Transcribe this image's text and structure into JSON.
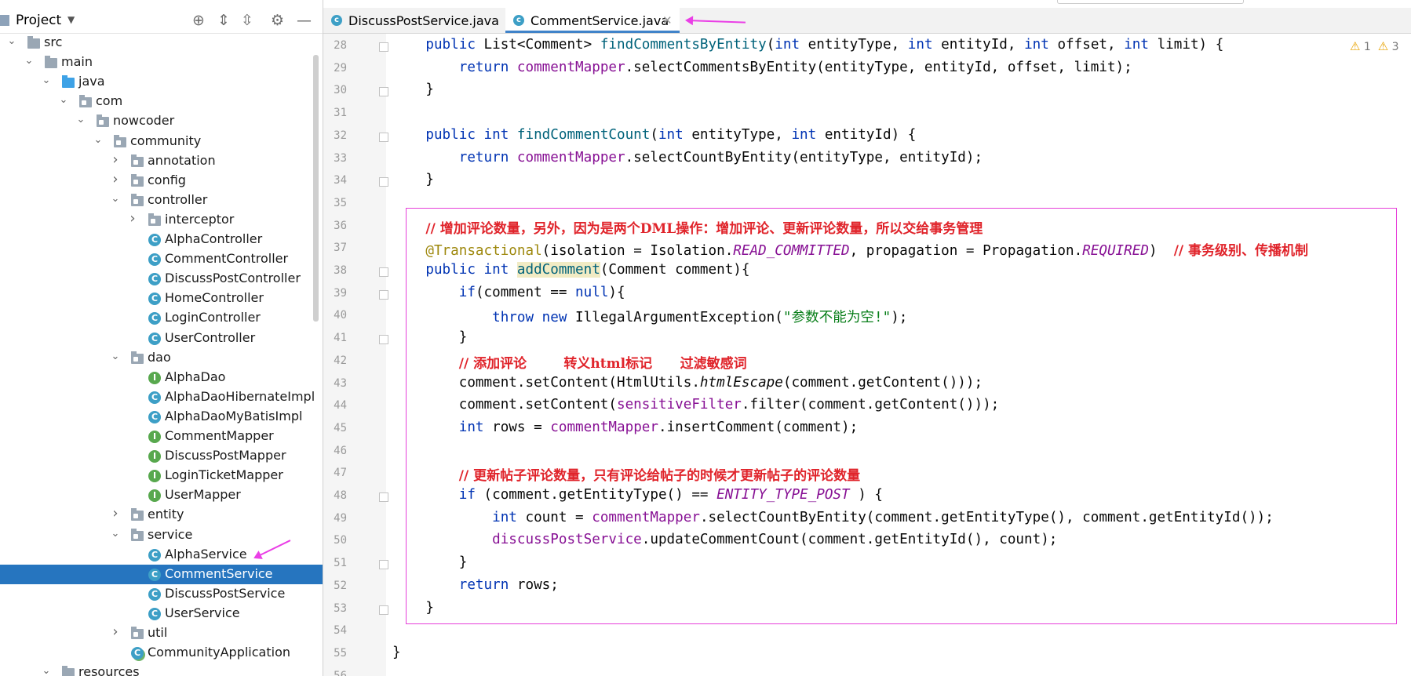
{
  "project_panel": {
    "title": "Project",
    "tree": [
      {
        "label": "src",
        "depth": 0,
        "expanded": true,
        "icon": "folder-icon"
      },
      {
        "label": "main",
        "depth": 1,
        "expanded": true,
        "icon": "folder-icon"
      },
      {
        "label": "java",
        "depth": 2,
        "expanded": true,
        "icon": "source-folder-icon"
      },
      {
        "label": "com",
        "depth": 3,
        "expanded": true,
        "icon": "package-icon"
      },
      {
        "label": "nowcoder",
        "depth": 4,
        "expanded": true,
        "icon": "package-icon"
      },
      {
        "label": "community",
        "depth": 5,
        "expanded": true,
        "icon": "package-icon"
      },
      {
        "label": "annotation",
        "depth": 6,
        "expanded": false,
        "icon": "package-icon"
      },
      {
        "label": "config",
        "depth": 6,
        "expanded": false,
        "icon": "package-icon"
      },
      {
        "label": "controller",
        "depth": 6,
        "expanded": true,
        "icon": "package-icon"
      },
      {
        "label": "interceptor",
        "depth": 7,
        "expanded": false,
        "icon": "package-icon"
      },
      {
        "label": "AlphaController",
        "depth": 7,
        "icon": "class-icon"
      },
      {
        "label": "CommentController",
        "depth": 7,
        "icon": "class-icon"
      },
      {
        "label": "DiscussPostController",
        "depth": 7,
        "icon": "class-icon"
      },
      {
        "label": "HomeController",
        "depth": 7,
        "icon": "class-icon"
      },
      {
        "label": "LoginController",
        "depth": 7,
        "icon": "class-icon"
      },
      {
        "label": "UserController",
        "depth": 7,
        "icon": "class-icon"
      },
      {
        "label": "dao",
        "depth": 6,
        "expanded": true,
        "icon": "package-icon"
      },
      {
        "label": "AlphaDao",
        "depth": 7,
        "icon": "interface-icon"
      },
      {
        "label": "AlphaDaoHibernateImpl",
        "depth": 7,
        "icon": "class-icon"
      },
      {
        "label": "AlphaDaoMyBatisImpl",
        "depth": 7,
        "icon": "class-icon"
      },
      {
        "label": "CommentMapper",
        "depth": 7,
        "icon": "interface-icon"
      },
      {
        "label": "DiscussPostMapper",
        "depth": 7,
        "icon": "interface-icon"
      },
      {
        "label": "LoginTicketMapper",
        "depth": 7,
        "icon": "interface-icon"
      },
      {
        "label": "UserMapper",
        "depth": 7,
        "icon": "interface-icon"
      },
      {
        "label": "entity",
        "depth": 6,
        "expanded": false,
        "icon": "package-icon"
      },
      {
        "label": "service",
        "depth": 6,
        "expanded": true,
        "icon": "package-icon"
      },
      {
        "label": "AlphaService",
        "depth": 7,
        "icon": "class-icon"
      },
      {
        "label": "CommentService",
        "depth": 7,
        "icon": "class-icon",
        "selected": true
      },
      {
        "label": "DiscussPostService",
        "depth": 7,
        "icon": "class-icon"
      },
      {
        "label": "UserService",
        "depth": 7,
        "icon": "class-icon"
      },
      {
        "label": "util",
        "depth": 6,
        "expanded": false,
        "icon": "package-icon"
      },
      {
        "label": "CommunityApplication",
        "depth": 6,
        "icon": "spring-app-icon"
      },
      {
        "label": "resources",
        "depth": 2,
        "expanded": true,
        "icon": "folder-icon"
      }
    ]
  },
  "tabs": [
    {
      "label": "DiscussPostService.java",
      "active": false
    },
    {
      "label": "CommentService.java",
      "active": true
    }
  ],
  "inspections": {
    "warnings": "1",
    "weak_warnings": "3"
  },
  "editor": {
    "lines": [
      {
        "n": "28",
        "tokens": [
          [
            "kw",
            "    public "
          ],
          [
            "",
            "List<Comment> "
          ],
          [
            "fn",
            "findCommentsByEntity"
          ],
          [
            "",
            "("
          ],
          [
            "kw",
            "int"
          ],
          [
            "",
            " entityType, "
          ],
          [
            "kw",
            "int"
          ],
          [
            "",
            " entityId, "
          ],
          [
            "kw",
            "int"
          ],
          [
            "",
            " offset, "
          ],
          [
            "kw",
            "int"
          ],
          [
            "",
            " limit) {"
          ]
        ]
      },
      {
        "n": "29",
        "tokens": [
          [
            "kw",
            "        return "
          ],
          [
            "fld",
            "commentMapper"
          ],
          [
            "",
            ".selectCommentsByEntity(entityType, entityId, offset, limit);"
          ]
        ]
      },
      {
        "n": "30",
        "tokens": [
          [
            "",
            "    }"
          ]
        ]
      },
      {
        "n": "31",
        "tokens": []
      },
      {
        "n": "32",
        "tokens": [
          [
            "kw",
            "    public int "
          ],
          [
            "fn",
            "findCommentCount"
          ],
          [
            "",
            "("
          ],
          [
            "kw",
            "int"
          ],
          [
            "",
            " entityType, "
          ],
          [
            "kw",
            "int"
          ],
          [
            "",
            " entityId) {"
          ]
        ]
      },
      {
        "n": "33",
        "tokens": [
          [
            "kw",
            "        return "
          ],
          [
            "fld",
            "commentMapper"
          ],
          [
            "",
            ".selectCountByEntity(entityType, entityId);"
          ]
        ]
      },
      {
        "n": "34",
        "tokens": [
          [
            "",
            "    }"
          ]
        ]
      },
      {
        "n": "35",
        "tokens": []
      },
      {
        "n": "36",
        "tokens": [
          [
            "",
            "    "
          ],
          [
            "cmt",
            "// 增加评论数量，另外，因为是两个DML操作：增加评论、更新评论数量，所以交给事务管理"
          ]
        ]
      },
      {
        "n": "37",
        "tokens": [
          [
            "ann",
            "    @Transactional"
          ],
          [
            "",
            "(isolation = Isolation."
          ],
          [
            "cst",
            "READ_COMMITTED"
          ],
          [
            "",
            ", propagation = Propagation."
          ],
          [
            "cst",
            "REQUIRED"
          ],
          [
            "",
            ")  "
          ],
          [
            "cmt",
            "// 事务级别、传播机制"
          ]
        ]
      },
      {
        "n": "38",
        "tokens": [
          [
            "kw",
            "    public int "
          ],
          [
            "fn hl",
            "addComment"
          ],
          [
            "",
            "(Comment comment){"
          ]
        ]
      },
      {
        "n": "39",
        "tokens": [
          [
            "kw",
            "        if"
          ],
          [
            "",
            "(comment == "
          ],
          [
            "kw",
            "null"
          ],
          [
            "",
            "){"
          ]
        ]
      },
      {
        "n": "40",
        "tokens": [
          [
            "kw",
            "            throw new "
          ],
          [
            "",
            "IllegalArgumentException("
          ],
          [
            "str",
            "\"参数不能为空!\""
          ],
          [
            "",
            ");"
          ]
        ]
      },
      {
        "n": "41",
        "tokens": [
          [
            "",
            "        }"
          ]
        ]
      },
      {
        "n": "42",
        "tokens": [
          [
            "",
            "        "
          ],
          [
            "cmt",
            "// 添加评论        转义html标记      过滤敏感词"
          ]
        ]
      },
      {
        "n": "43",
        "tokens": [
          [
            "",
            "        comment.setContent(HtmlUtils."
          ],
          [
            "ital",
            "htmlEscape"
          ],
          [
            "",
            "(comment.getContent()));"
          ]
        ]
      },
      {
        "n": "44",
        "tokens": [
          [
            "",
            "        comment.setContent("
          ],
          [
            "fld",
            "sensitiveFilter"
          ],
          [
            "",
            ".filter(comment.getContent()));"
          ]
        ]
      },
      {
        "n": "45",
        "tokens": [
          [
            "kw",
            "        int"
          ],
          [
            "",
            " rows = "
          ],
          [
            "fld",
            "commentMapper"
          ],
          [
            "",
            ".insertComment(comment);"
          ]
        ]
      },
      {
        "n": "46",
        "tokens": []
      },
      {
        "n": "47",
        "tokens": [
          [
            "",
            "        "
          ],
          [
            "cmt",
            "// 更新帖子评论数量，只有评论给帖子的时候才更新帖子的评论数量"
          ]
        ]
      },
      {
        "n": "48",
        "tokens": [
          [
            "kw",
            "        if"
          ],
          [
            "",
            " (comment.getEntityType() == "
          ],
          [
            "cst",
            "ENTITY_TYPE_POST"
          ],
          [
            "",
            " ) {"
          ]
        ]
      },
      {
        "n": "49",
        "tokens": [
          [
            "kw",
            "            int"
          ],
          [
            "",
            " count = "
          ],
          [
            "fld",
            "commentMapper"
          ],
          [
            "",
            ".selectCountByEntity(comment.getEntityType(), comment.getEntityId());"
          ]
        ]
      },
      {
        "n": "50",
        "tokens": [
          [
            "fld",
            "            discussPostService"
          ],
          [
            "",
            ".updateCommentCount(comment.getEntityId(), count);"
          ]
        ]
      },
      {
        "n": "51",
        "tokens": [
          [
            "",
            "        }"
          ]
        ]
      },
      {
        "n": "52",
        "tokens": [
          [
            "kw",
            "        return"
          ],
          [
            "",
            " rows;"
          ]
        ]
      },
      {
        "n": "53",
        "tokens": [
          [
            "",
            "    }"
          ]
        ]
      },
      {
        "n": "54",
        "tokens": []
      },
      {
        "n": "55",
        "tokens": [
          [
            "",
            "}"
          ]
        ]
      },
      {
        "n": "56",
        "tokens": []
      }
    ]
  },
  "colors": {
    "selection": "#2675bf",
    "annotation_box": "#e63fd9",
    "arrow": "#ea3fe6",
    "comment": "#e0242b"
  }
}
